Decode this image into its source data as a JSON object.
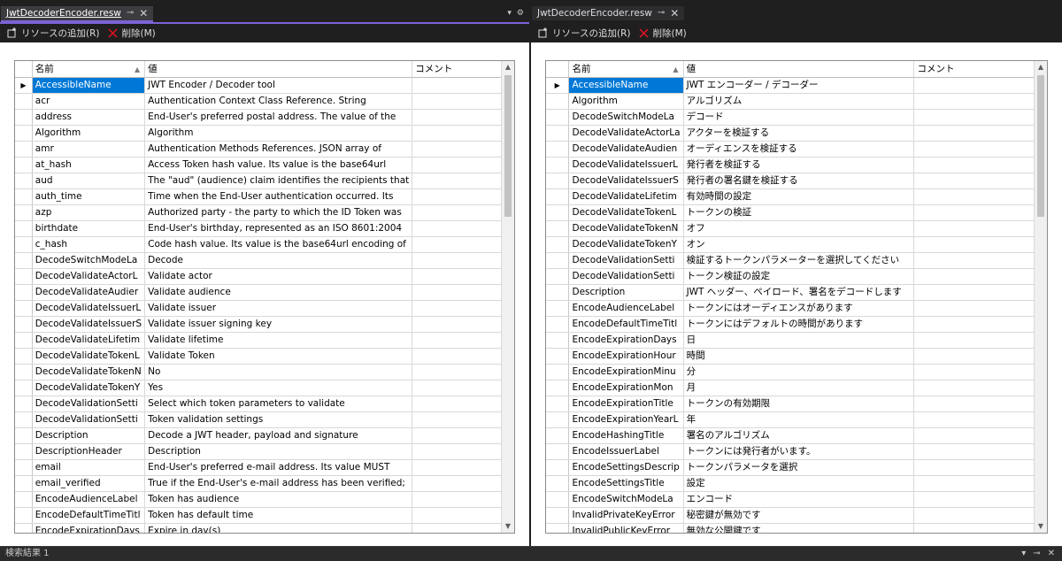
{
  "left": {
    "tab_title": "JwtDecoderEncoder.resw",
    "toolbar": {
      "add": "リソースの追加(R)",
      "delete": "削除(M)"
    },
    "columns": {
      "name": "名前",
      "value": "値",
      "comment": "コメント"
    },
    "rows": [
      {
        "name": "AccessibleName",
        "value": "JWT Encoder / Decoder tool",
        "comment": ""
      },
      {
        "name": "acr",
        "value": "Authentication Context Class Reference. String",
        "comment": ""
      },
      {
        "name": "address",
        "value": "End-User's preferred postal address. The value of the",
        "comment": ""
      },
      {
        "name": "Algorithm",
        "value": "Algorithm",
        "comment": ""
      },
      {
        "name": "amr",
        "value": "Authentication Methods References. JSON array of",
        "comment": ""
      },
      {
        "name": "at_hash",
        "value": "Access Token hash value. Its value is the base64url",
        "comment": ""
      },
      {
        "name": "aud",
        "value": "The \"aud\" (audience) claim identifies the recipients that",
        "comment": ""
      },
      {
        "name": "auth_time",
        "value": "Time when the End-User authentication occurred. Its",
        "comment": ""
      },
      {
        "name": "azp",
        "value": "Authorized party - the party to which the ID Token was",
        "comment": ""
      },
      {
        "name": "birthdate",
        "value": "End-User's birthday, represented as an ISO 8601:2004",
        "comment": ""
      },
      {
        "name": "c_hash",
        "value": "Code hash value. Its value is the base64url encoding of",
        "comment": ""
      },
      {
        "name": "DecodeSwitchModeLa",
        "value": "Decode",
        "comment": ""
      },
      {
        "name": "DecodeValidateActorL",
        "value": "Validate actor",
        "comment": ""
      },
      {
        "name": "DecodeValidateAudier",
        "value": "Validate audience",
        "comment": ""
      },
      {
        "name": "DecodeValidateIssuerL",
        "value": "Validate issuer",
        "comment": ""
      },
      {
        "name": "DecodeValidateIssuerS",
        "value": "Validate issuer signing key",
        "comment": ""
      },
      {
        "name": "DecodeValidateLifetim",
        "value": "Validate lifetime",
        "comment": ""
      },
      {
        "name": "DecodeValidateTokenL",
        "value": "Validate Token",
        "comment": ""
      },
      {
        "name": "DecodeValidateTokenN",
        "value": "No",
        "comment": ""
      },
      {
        "name": "DecodeValidateTokenY",
        "value": "Yes",
        "comment": ""
      },
      {
        "name": "DecodeValidationSetti",
        "value": "Select which token parameters to validate",
        "comment": ""
      },
      {
        "name": "DecodeValidationSetti",
        "value": "Token validation settings",
        "comment": ""
      },
      {
        "name": "Description",
        "value": "Decode a JWT header, payload and signature",
        "comment": ""
      },
      {
        "name": "DescriptionHeader",
        "value": "Description",
        "comment": ""
      },
      {
        "name": "email",
        "value": "End-User's preferred e-mail address. Its value MUST",
        "comment": ""
      },
      {
        "name": "email_verified",
        "value": "True if the End-User's e-mail address has been verified;",
        "comment": ""
      },
      {
        "name": "EncodeAudienceLabel",
        "value": "Token has audience",
        "comment": ""
      },
      {
        "name": "EncodeDefaultTimeTitl",
        "value": "Token has default time",
        "comment": ""
      },
      {
        "name": "EncodeExpirationDays",
        "value": "Expire in day(s)",
        "comment": ""
      }
    ]
  },
  "right": {
    "tab_title": "JwtDecoderEncoder.resw",
    "toolbar": {
      "add": "リソースの追加(R)",
      "delete": "削除(M)"
    },
    "columns": {
      "name": "名前",
      "value": "値",
      "comment": "コメント"
    },
    "rows": [
      {
        "name": "AccessibleName",
        "value": "JWT エンコーダー / デコーダー",
        "comment": ""
      },
      {
        "name": "Algorithm",
        "value": "アルゴリズム",
        "comment": ""
      },
      {
        "name": "DecodeSwitchModeLa",
        "value": "デコード",
        "comment": ""
      },
      {
        "name": "DecodeValidateActorLa",
        "value": "アクターを検証する",
        "comment": ""
      },
      {
        "name": "DecodeValidateAudien",
        "value": "オーディエンスを検証する",
        "comment": ""
      },
      {
        "name": "DecodeValidateIssuerL",
        "value": "発行者を検証する",
        "comment": ""
      },
      {
        "name": "DecodeValidateIssuerS",
        "value": "発行者の署名鍵を検証する",
        "comment": ""
      },
      {
        "name": "DecodeValidateLifetim",
        "value": "有効時間の設定",
        "comment": ""
      },
      {
        "name": "DecodeValidateTokenL",
        "value": "トークンの検証",
        "comment": ""
      },
      {
        "name": "DecodeValidateTokenN",
        "value": "オフ",
        "comment": ""
      },
      {
        "name": "DecodeValidateTokenY",
        "value": "オン",
        "comment": ""
      },
      {
        "name": "DecodeValidationSetti",
        "value": "検証するトークンパラメーターを選択してください",
        "comment": ""
      },
      {
        "name": "DecodeValidationSetti",
        "value": "トークン検証の設定",
        "comment": ""
      },
      {
        "name": "Description",
        "value": "JWT ヘッダー、ペイロード、署名をデコードします",
        "comment": ""
      },
      {
        "name": "EncodeAudienceLabel",
        "value": "トークンにはオーディエンスがあります",
        "comment": ""
      },
      {
        "name": "EncodeDefaultTimeTitl",
        "value": "トークンにはデフォルトの時間があります",
        "comment": ""
      },
      {
        "name": "EncodeExpirationDays",
        "value": "日",
        "comment": ""
      },
      {
        "name": "EncodeExpirationHour",
        "value": "時間",
        "comment": ""
      },
      {
        "name": "EncodeExpirationMinu",
        "value": "分",
        "comment": ""
      },
      {
        "name": "EncodeExpirationMon",
        "value": "月",
        "comment": ""
      },
      {
        "name": "EncodeExpirationTitle",
        "value": "トークンの有効期限",
        "comment": ""
      },
      {
        "name": "EncodeExpirationYearL",
        "value": "年",
        "comment": ""
      },
      {
        "name": "EncodeHashingTitle",
        "value": "署名のアルゴリズム",
        "comment": ""
      },
      {
        "name": "EncodeIssuerLabel",
        "value": "トークンには発行者がいます。",
        "comment": ""
      },
      {
        "name": "EncodeSettingsDescrip",
        "value": "トークンパラメータを選択",
        "comment": ""
      },
      {
        "name": "EncodeSettingsTitle",
        "value": "設定",
        "comment": ""
      },
      {
        "name": "EncodeSwitchModeLa",
        "value": "エンコード",
        "comment": ""
      },
      {
        "name": "InvalidPrivateKeyError",
        "value": "秘密鍵が無効です",
        "comment": ""
      },
      {
        "name": "InvalidPublicKeyError",
        "value": "無効な公開鍵です",
        "comment": ""
      }
    ]
  },
  "bottom_panel": {
    "title": "検索結果 1"
  },
  "icons": {
    "add": "add-resource-icon",
    "delete": "delete-x-icon",
    "pin": "pin-icon",
    "close": "close-icon",
    "row_pointer": "row-pointer-icon"
  },
  "colors": {
    "accent": "#7b63d6",
    "selection": "#0078d7",
    "delete": "#e81123"
  }
}
